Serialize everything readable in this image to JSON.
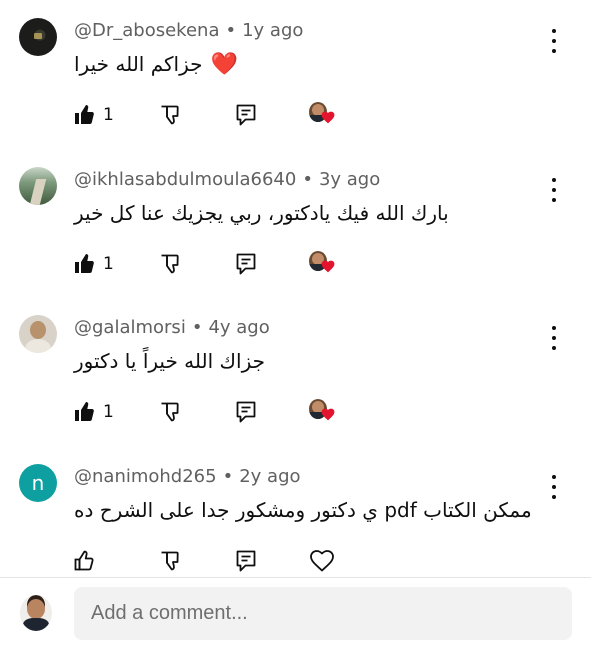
{
  "comments": [
    {
      "author": "@Dr_abosekena",
      "separator": "•",
      "age": "1y ago",
      "text": "جزاكم الله خيرا",
      "emoji": "❤️",
      "like_count": "1",
      "creator_hearted": true,
      "avatar": "dark-logo"
    },
    {
      "author": "@ikhlasabdulmoula6640",
      "separator": "•",
      "age": "3y ago",
      "text": "بارك الله فيك يادكتور،  ربي يجزيك عنا كل خير",
      "like_count": "1",
      "creator_hearted": true,
      "avatar": "road-photo"
    },
    {
      "author": "@galalmorsi",
      "separator": "•",
      "age": "4y ago",
      "text": "جزاك الله خيراً يا دكتور",
      "like_count": "1",
      "creator_hearted": true,
      "avatar": "person-photo"
    },
    {
      "author": "@nanimohd265",
      "separator": "•",
      "age": "2y ago",
      "text": "ممكن الكتاب pdf ي دكتور ومشكور جدا على الشرح ده",
      "like_count": "",
      "creator_hearted": false,
      "avatar_letter": "n",
      "avatar_color": "#0e9fa0"
    }
  ],
  "composer": {
    "placeholder": "Add a comment..."
  },
  "colors": {
    "heart": "#e3142d",
    "meta_text": "#606060"
  },
  "icons": [
    "like-icon",
    "dislike-icon",
    "reply-icon",
    "creator-heart-icon",
    "heart-outline-icon",
    "more-options-icon"
  ]
}
